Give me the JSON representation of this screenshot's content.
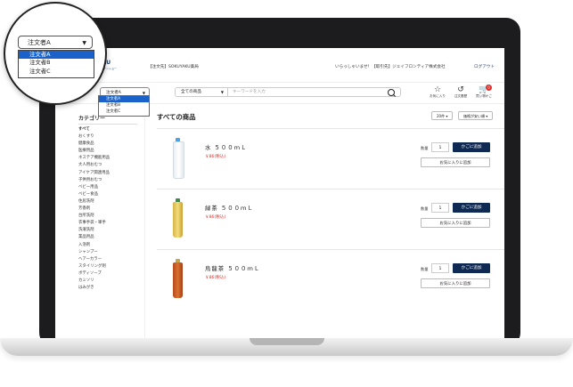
{
  "header": {
    "logo": "AKU",
    "logo_sub": "ンラインショー",
    "client": "【注文先】SOKUYAKU薬局",
    "welcome": "いらっしゃいませ！【取引先】ジェイフロンティア株式会社",
    "logout": "ログアウト"
  },
  "orderer": {
    "selected": "注文者A",
    "options": [
      "注文者A",
      "注文者B",
      "注文者C"
    ]
  },
  "search": {
    "category": "全ての商品",
    "placeholder": "キーワードを入力"
  },
  "nav": {
    "favorites": "お気に入り",
    "history": "注文履歴",
    "cart": "買い物かご",
    "cart_count": "0"
  },
  "sidebar": {
    "title": "カテゴリー",
    "items": [
      "すべて",
      "おくすり",
      "健康食品",
      "医療用品",
      "ネステア機能用品",
      "大人用おむつ",
      "アイケア関連用品",
      "子供用おむつ",
      "ベビー用品",
      "ベビー食品",
      "住居洗剤",
      "芳香剤",
      "台所洗剤",
      "衣事手袋・軍手",
      "洗濯洗剤",
      "業品用品",
      "入浴剤",
      "シャンプー",
      "ヘアーカラー",
      "スタイリング剤",
      "ボディソープ",
      "カミソリ",
      "はみがき"
    ]
  },
  "main": {
    "title": "すべての商品",
    "per_page": "20件",
    "sort": "価格が安い順"
  },
  "products": [
    {
      "name": "水 ５００ｍＬ",
      "price": "￥86(税込)",
      "qty_label": "数量",
      "qty": "1",
      "add_label": "かごに追加",
      "fav_label": "お気に入りに追加"
    },
    {
      "name": "緑茶 ５００ｍＬ",
      "price": "￥86(税込)",
      "qty_label": "数量",
      "qty": "1",
      "add_label": "かごに追加",
      "fav_label": "お気に入りに追加"
    },
    {
      "name": "烏龍茶 ５００ｍＬ",
      "price": "￥86(税込)",
      "qty_label": "数量",
      "qty": "1",
      "add_label": "かごに追加",
      "fav_label": "お気に入りに追加"
    }
  ],
  "colors": {
    "accent": "#0f2a52",
    "price": "#d9322e",
    "selection": "#1a62c9"
  }
}
